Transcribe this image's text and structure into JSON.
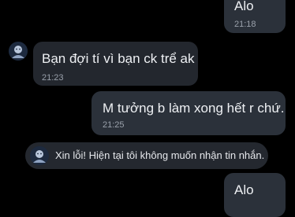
{
  "messages": [
    {
      "direction": "outgoing",
      "text": "Alo",
      "time": "21:18"
    },
    {
      "direction": "incoming",
      "text": "Bạn đợi tí vì bạn ck trể ak",
      "time": "21:23"
    },
    {
      "direction": "outgoing",
      "text": "M tưởng b làm xong hết r chứ.",
      "time": "21:25"
    },
    {
      "direction": "outgoing",
      "text": "Alo"
    }
  ],
  "auto_reply": {
    "text": "Xin lỗi! Hiện tại tôi không muốn nhận tin nhắn."
  },
  "colors": {
    "background": "#000000",
    "outgoing_bubble": "#2b313a",
    "incoming_bubble": "#23272e",
    "timestamp": "#9aa1ab",
    "text": "#eef0f3"
  },
  "icons": {
    "contact_avatar": "avatar-icon"
  }
}
